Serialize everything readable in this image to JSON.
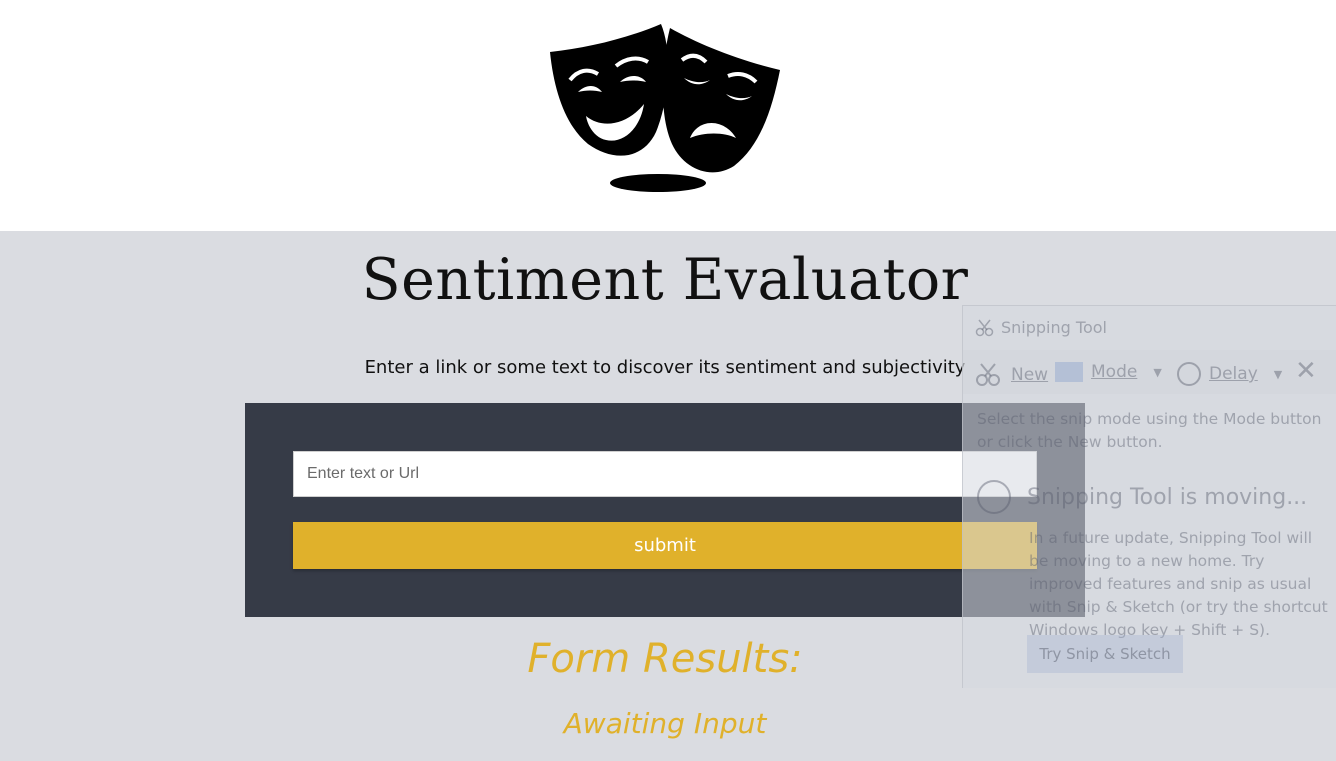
{
  "header": {
    "logo_icon": "theater-masks-icon"
  },
  "main": {
    "title": "Sentiment Evaluator",
    "subtitle": "Enter a link or some text to discover its sentiment and subjectivity",
    "form": {
      "input_placeholder": "Enter text or Url",
      "input_value": "",
      "submit_label": "submit"
    },
    "results": {
      "title": "Form Results:",
      "status": "Awaiting Input"
    }
  },
  "snipping_tool": {
    "title": "Snipping Tool",
    "toolbar": {
      "new_label": "New",
      "mode_label": "Mode",
      "delay_label": "Delay"
    },
    "hint": "Select the snip mode using the Mode button or click the New button.",
    "moving_heading": "Snipping Tool is moving...",
    "moving_body": "In a future update, Snipping Tool will be moving to a new home. Try improved features and snip as usual with Snip & Sketch (or try the shortcut Windows logo key + Shift + S).",
    "try_button_label": "Try Snip & Sketch"
  },
  "colors": {
    "accent": "#e0b12b",
    "card": "#363b47",
    "page_bg": "#dadce1"
  }
}
